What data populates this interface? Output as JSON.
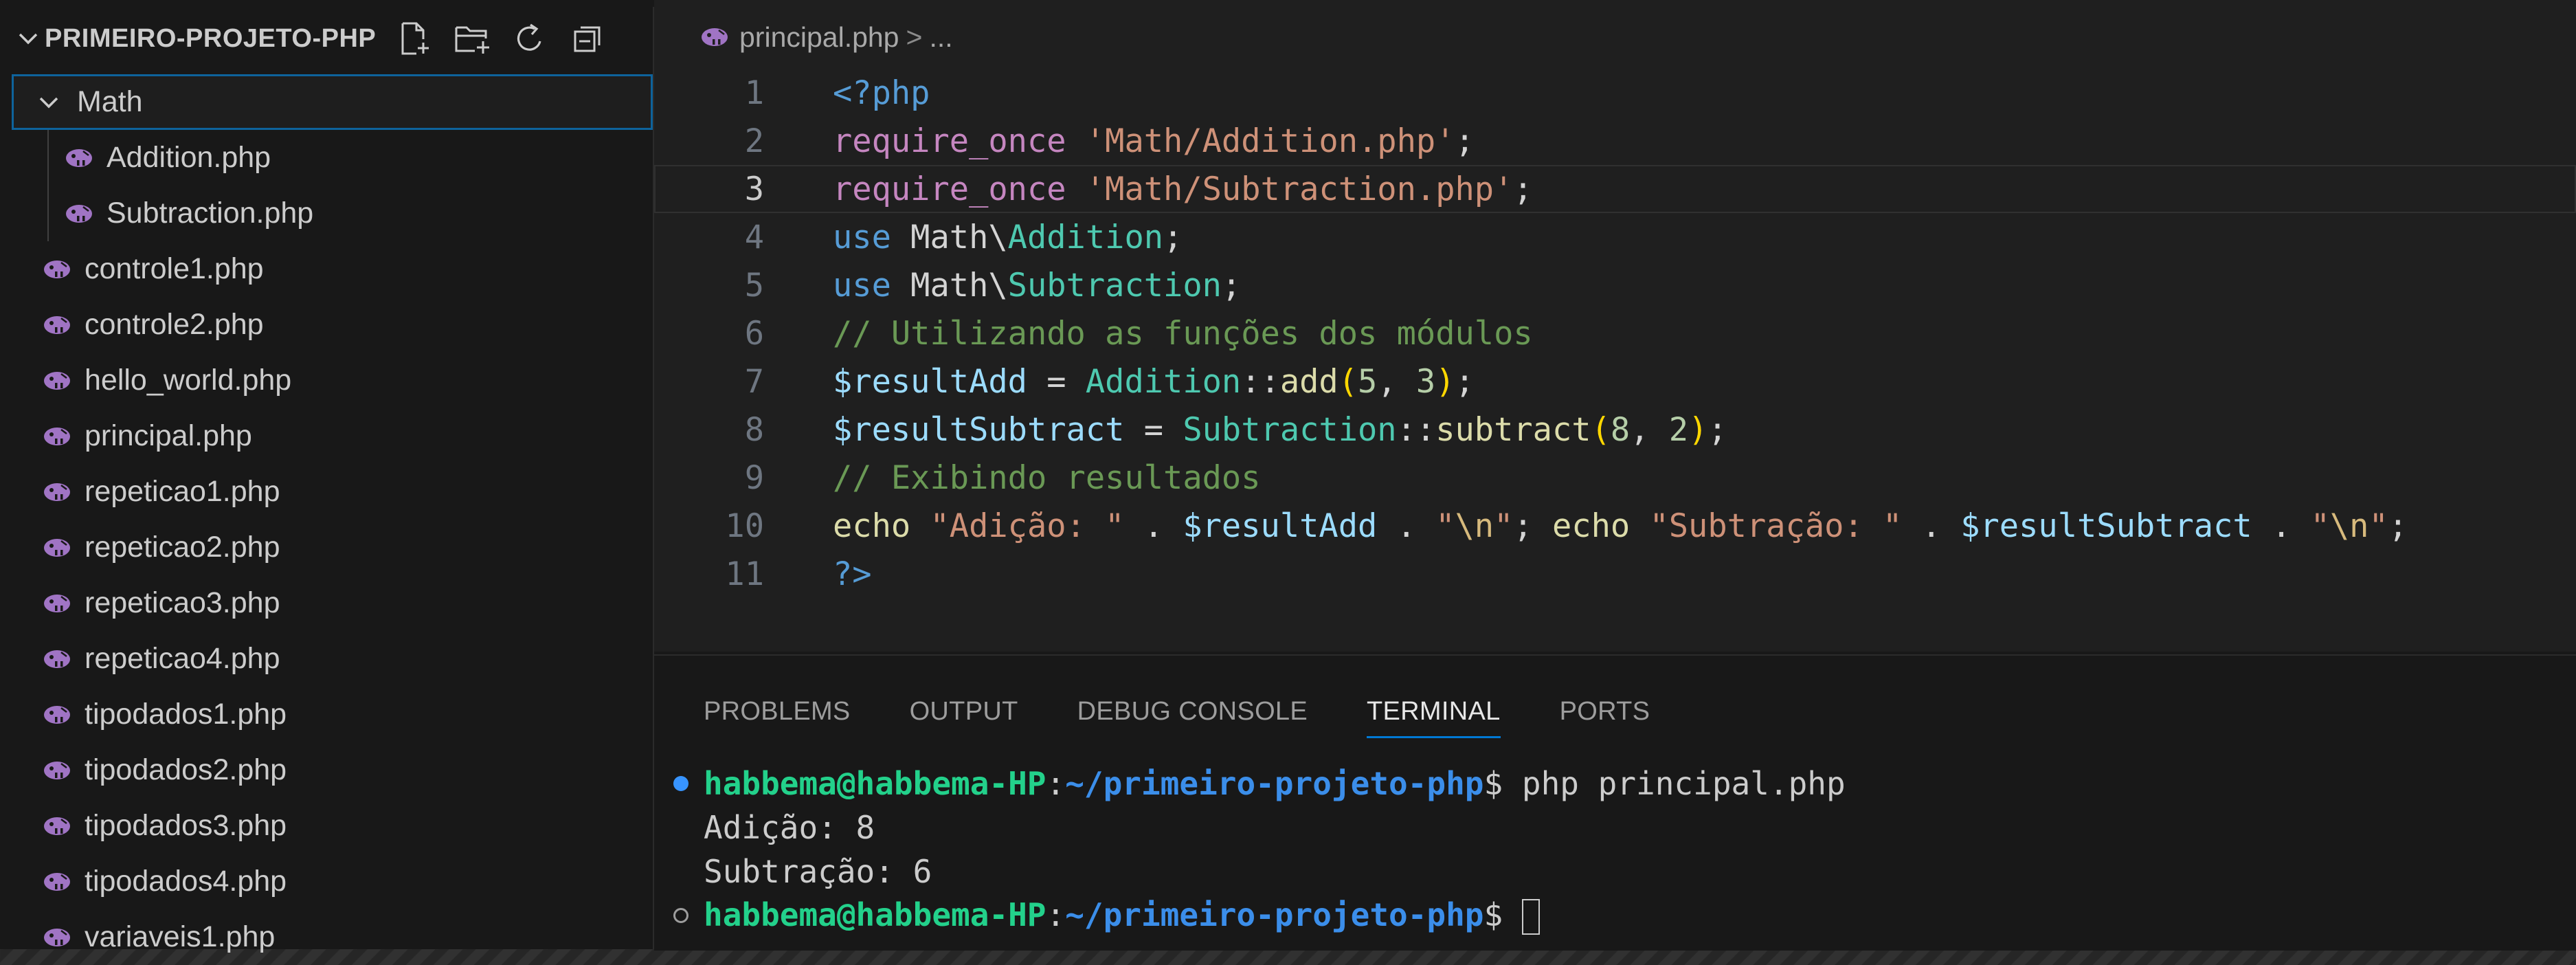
{
  "explorer": {
    "title": "PRIMEIRO-PROJETO-PHP",
    "actions": [
      "new-file-icon",
      "new-folder-icon",
      "refresh-icon",
      "collapse-all-icon"
    ],
    "folder": "Math",
    "folder_children": [
      "Addition.php",
      "Subtraction.php"
    ],
    "files": [
      "controle1.php",
      "controle2.php",
      "hello_world.php",
      "principal.php",
      "repeticao1.php",
      "repeticao2.php",
      "repeticao3.php",
      "repeticao4.php",
      "tipodados1.php",
      "tipodados2.php",
      "tipodados3.php",
      "tipodados4.php",
      "variaveis1.php"
    ]
  },
  "editor": {
    "breadcrumb_file": "principal.php",
    "breadcrumb_sep": ">",
    "breadcrumb_more": "...",
    "current_line": 3,
    "line_numbers": [
      "1",
      "2",
      "3",
      "4",
      "5",
      "6",
      "7",
      "8",
      "9",
      "10",
      "11"
    ],
    "lines": [
      [
        [
          "tag",
          "<?php"
        ]
      ],
      [
        [
          "kw",
          "require_once"
        ],
        [
          "default",
          " "
        ],
        [
          "str",
          "'Math/Addition.php'"
        ],
        [
          "punct",
          ";"
        ]
      ],
      [
        [
          "kw",
          "require_once"
        ],
        [
          "default",
          " "
        ],
        [
          "str",
          "'Math/Subtraction.php'"
        ],
        [
          "punct",
          ";"
        ]
      ],
      [
        [
          "tag",
          "use"
        ],
        [
          "default",
          " Math\\"
        ],
        [
          "class",
          "Addition"
        ],
        [
          "punct",
          ";"
        ]
      ],
      [
        [
          "tag",
          "use"
        ],
        [
          "default",
          " Math\\"
        ],
        [
          "class",
          "Subtraction"
        ],
        [
          "punct",
          ";"
        ]
      ],
      [
        [
          "comment",
          "// Utilizando as funções dos módulos"
        ]
      ],
      [
        [
          "var",
          "$resultAdd"
        ],
        [
          "default",
          " = "
        ],
        [
          "class",
          "Addition"
        ],
        [
          "default",
          "::"
        ],
        [
          "func",
          "add"
        ],
        [
          "paren",
          "("
        ],
        [
          "num",
          "5"
        ],
        [
          "default",
          ", "
        ],
        [
          "num",
          "3"
        ],
        [
          "paren",
          ")"
        ],
        [
          "punct",
          ";"
        ]
      ],
      [
        [
          "var",
          "$resultSubtract"
        ],
        [
          "default",
          " = "
        ],
        [
          "class",
          "Subtraction"
        ],
        [
          "default",
          "::"
        ],
        [
          "func",
          "subtract"
        ],
        [
          "paren",
          "("
        ],
        [
          "num",
          "8"
        ],
        [
          "default",
          ", "
        ],
        [
          "num",
          "2"
        ],
        [
          "paren",
          ")"
        ],
        [
          "punct",
          ";"
        ]
      ],
      [
        [
          "comment",
          "// Exibindo resultados"
        ]
      ],
      [
        [
          "func",
          "echo"
        ],
        [
          "default",
          " "
        ],
        [
          "str",
          "\"Adição: \""
        ],
        [
          "default",
          " . "
        ],
        [
          "var",
          "$resultAdd"
        ],
        [
          "default",
          " . "
        ],
        [
          "str",
          "\""
        ],
        [
          "esc",
          "\\n"
        ],
        [
          "str",
          "\""
        ],
        [
          "punct",
          "; "
        ],
        [
          "func",
          "echo"
        ],
        [
          "default",
          " "
        ],
        [
          "str",
          "\"Subtração: \""
        ],
        [
          "default",
          " . "
        ],
        [
          "var",
          "$resultSubtract"
        ],
        [
          "default",
          " . "
        ],
        [
          "str",
          "\""
        ],
        [
          "esc",
          "\\n"
        ],
        [
          "str",
          "\""
        ],
        [
          "punct",
          ";"
        ]
      ],
      [
        [
          "tag",
          "?>"
        ]
      ]
    ]
  },
  "panel": {
    "tabs": [
      "PROBLEMS",
      "OUTPUT",
      "DEBUG CONSOLE",
      "TERMINAL",
      "PORTS"
    ],
    "active_tab": "TERMINAL",
    "terminal": {
      "user_host": "habbema@habbema-HP",
      "colon": ":",
      "path": "~/primeiro-projeto-php",
      "prompt": "$ ",
      "command": "php principal.php",
      "output": [
        "Adição: 8",
        "Subtração: 6"
      ]
    }
  },
  "colors": {
    "accent": "#0078d4",
    "folder_focus_border": "#0e639c",
    "terminal_user": "#23d18b",
    "terminal_path": "#3b8eea"
  }
}
